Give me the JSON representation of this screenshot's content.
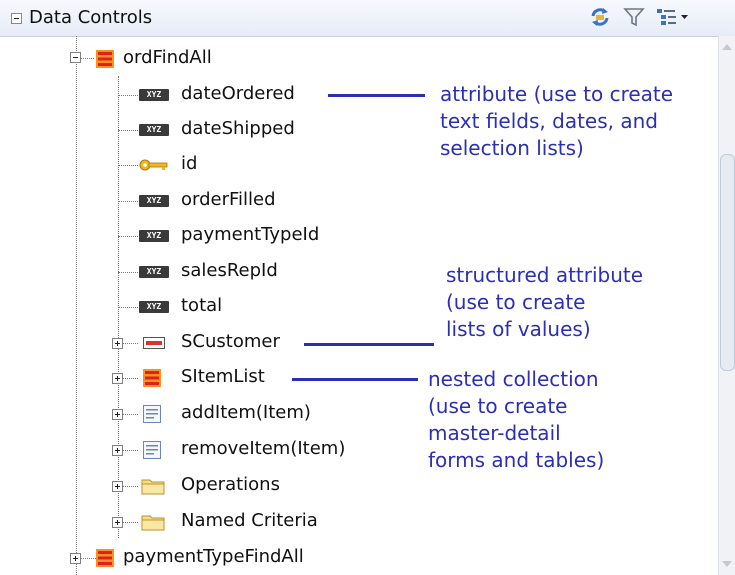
{
  "header": {
    "title": "Data Controls",
    "refresh_icon": "refresh-icon",
    "filter_icon": "filter-icon",
    "view_icon": "tree-options-icon"
  },
  "tree": {
    "root_collection": "ordFindAll",
    "attributes": [
      "dateOrdered",
      "dateShipped",
      "id",
      "orderFilled",
      "paymentTypeId",
      "salesRepId",
      "total"
    ],
    "attr_badge": "XYZ",
    "structured": "SCustomer",
    "nested": "SItemList",
    "methods": [
      "addItem(Item)",
      "removeItem(Item)"
    ],
    "folders": [
      "Operations",
      "Named Criteria"
    ],
    "next_collection": "paymentTypeFindAll"
  },
  "annotations": {
    "attribute": [
      "attribute (use to create",
      "text fields, dates, and",
      "selection lists)"
    ],
    "structured": [
      "structured attribute",
      "(use to create",
      "lists of values)"
    ],
    "nested": [
      "nested collection",
      "(use to create",
      "master-detail",
      "forms and tables)"
    ]
  },
  "colors": {
    "annotation": "#2b2fb4"
  }
}
